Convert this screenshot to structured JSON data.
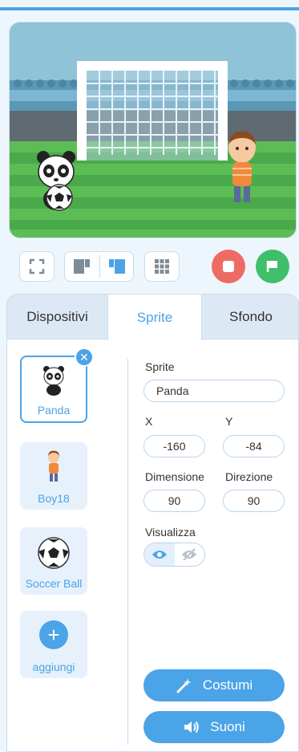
{
  "colors": {
    "accent": "#4ba3e8",
    "stop": "#ee6b63",
    "go": "#3fbf6a"
  },
  "stage_controls": {
    "fullscreen_icon": "fullscreen-icon",
    "small_stage_icon": "small-stage-layout-icon",
    "large_stage_icon": "large-stage-layout-icon",
    "grid_icon": "grid-icon",
    "stop_icon": "stop-icon",
    "green_flag_icon": "green-flag-icon"
  },
  "tabs": [
    {
      "label": "Dispositivi"
    },
    {
      "label": "Sprite"
    },
    {
      "label": "Sfondo"
    }
  ],
  "sprites": [
    {
      "name": "Panda",
      "selected": true
    },
    {
      "name": "Boy18",
      "selected": false
    },
    {
      "name": "Soccer Ball",
      "selected": false
    }
  ],
  "add_sprite": {
    "label": "aggiungi"
  },
  "properties": {
    "sprite_label": "Sprite",
    "sprite_name": "Panda",
    "x_label": "X",
    "x_value": "-160",
    "y_label": "Y",
    "y_value": "-84",
    "size_label": "Dimensione",
    "size_value": "90",
    "direction_label": "Direzione",
    "direction_value": "90",
    "visibility_label": "Visualizza"
  },
  "buttons": {
    "costumes_label": "Costumi",
    "sounds_label": "Suoni"
  }
}
